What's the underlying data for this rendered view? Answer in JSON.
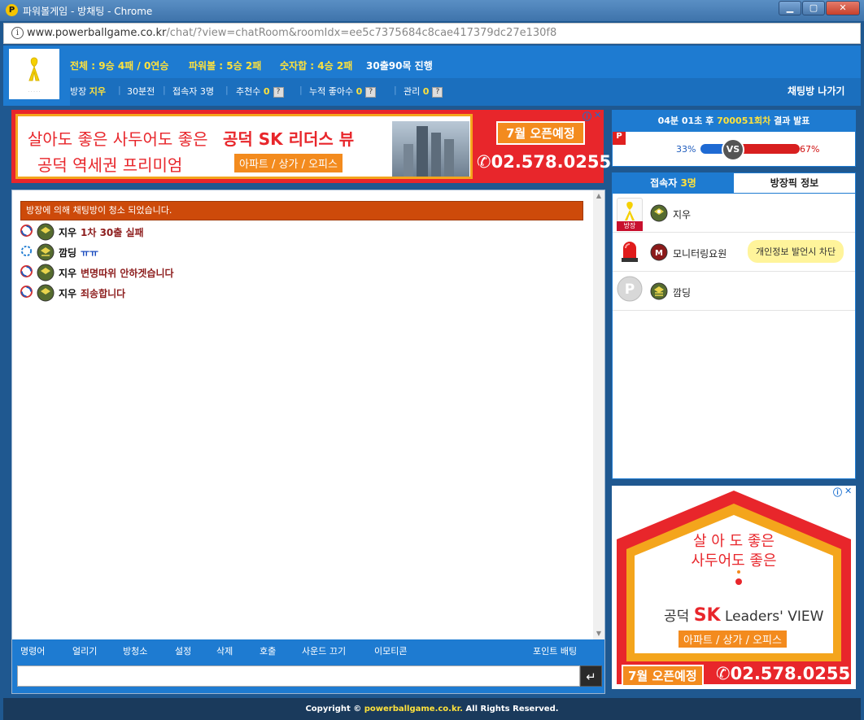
{
  "window": {
    "title": "파워볼게임 - 방채팅 - Chrome",
    "url_host": "www.powerballgame.co.kr",
    "url_path": "/chat/?view=chatRoom&roomIdx=ee5c7375684c8cae417379dc27e130f8"
  },
  "header": {
    "stats": {
      "total_label": "전체 : ",
      "total_value": "9승 4패 / 0연승",
      "powerball_label": "파워볼 : ",
      "powerball_value": "5승 2패",
      "sum_label": "숫자합 : ",
      "sum_value": "4승 2패",
      "progress": "30출90목 진행"
    },
    "info": {
      "owner_label": "방장",
      "owner_name": "지우",
      "time": "30분전",
      "users_label": "접속자",
      "users_count": "3명",
      "recommend_label": "추천수",
      "recommend_value": "0",
      "likes_label": "누적 좋아수",
      "likes_value": "0",
      "manage_label": "관리",
      "manage_value": "0",
      "help": "?"
    },
    "exit_label": "채팅방 나가기"
  },
  "ad_top": {
    "line1": "살아도 좋은 사두어도 좋은",
    "line2": "공덕 역세권 프리미엄",
    "brand": "공덕 SK 리더스 뷰",
    "tag": "아파트 / 상가 / 오피스",
    "open": "7월 오픈예정",
    "phone": "02.578.0255"
  },
  "result": {
    "time": "04분 01초 후",
    "round": "700051회차",
    "suffix": "결과 발표",
    "p_badge": "P",
    "left_pct": "33%",
    "right_pct": "67%",
    "left_fraction": 0.33,
    "vs": "VS"
  },
  "users": {
    "tab_users_label": "접속자",
    "tab_users_count": "3명",
    "tab_info_label": "방장픽 정보",
    "owner_badge": "방장",
    "list": [
      {
        "name": "지우"
      },
      {
        "name": "모니터링요원",
        "tooltip": "개인정보 발언시 차단"
      },
      {
        "name": "깜딩"
      }
    ]
  },
  "chat": {
    "notice": "방장에 의해 채팅방이 청소 되었습니다.",
    "messages": [
      {
        "name": "지우",
        "text": "1차 30출 실패"
      },
      {
        "name": "깜딩",
        "text": "ㅠㅠ"
      },
      {
        "name": "지우",
        "text": "변명따위 안하겟습니다"
      },
      {
        "name": "지우",
        "text": "죄송합니다"
      }
    ],
    "toolbar": {
      "command": "명령어",
      "freeze": "얼리기",
      "clean": "방청소",
      "settings": "설정",
      "delete": "삭제",
      "call": "호출",
      "sound_off": "사운드 끄기",
      "emoticon": "이모티콘",
      "point_bet": "포인트 배팅"
    },
    "input_value": "",
    "send_icon": "↵"
  },
  "ad_right": {
    "line1": "살 아 도 좋은",
    "line2": "사두어도 좋은",
    "brand_pre": "공덕",
    "brand_sk": "SK",
    "brand_post": "Leaders' VIEW",
    "tag": "아파트 / 상가 / 오피스",
    "open": "7월 오픈예정",
    "phone": "02.578.0255"
  },
  "footer": {
    "prefix": "Copyright ©",
    "site": "powerballgame.co.kr.",
    "suffix": "All Rights Reserved."
  },
  "colors": {
    "primary_blue": "#1e7bd1",
    "accent_yellow": "#ffe23b",
    "notice_orange": "#cd4a0a",
    "ad_red": "#e8262b"
  },
  "icons": {
    "app": "powerball-logo-icon",
    "info": "info-icon",
    "ribbon": "yellow-ribbon-icon",
    "level": "soldier-level-icon",
    "swirl": "swirl-icon",
    "siren": "siren-icon",
    "send": "enter-icon"
  }
}
